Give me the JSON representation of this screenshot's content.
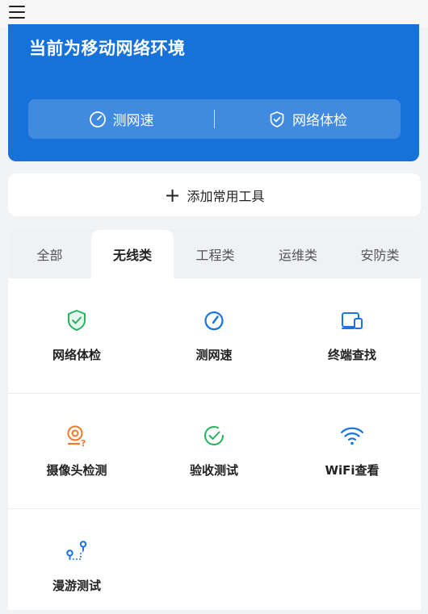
{
  "hero": {
    "title": "当前为移动网络环境",
    "speed_test_label": "测网速",
    "network_check_label": "网络体检"
  },
  "add_tools": {
    "label": "添加常用工具"
  },
  "tabs": [
    {
      "label": "全部",
      "active": false
    },
    {
      "label": "无线类",
      "active": true
    },
    {
      "label": "工程类",
      "active": false
    },
    {
      "label": "运维类",
      "active": false
    },
    {
      "label": "安防类",
      "active": false
    }
  ],
  "tools": [
    {
      "label": "网络体检",
      "icon": "shield-check-icon",
      "color": "#22b35e"
    },
    {
      "label": "测网速",
      "icon": "speedometer-icon",
      "color": "#1b75de"
    },
    {
      "label": "终端查找",
      "icon": "device-search-icon",
      "color": "#1b75de"
    },
    {
      "label": "摄像头检测",
      "icon": "camera-detect-icon",
      "color": "#f07a28"
    },
    {
      "label": "验收测试",
      "icon": "acceptance-check-icon",
      "color": "#22b35e"
    },
    {
      "label": "WiFi查看",
      "icon": "wifi-icon",
      "color": "#1b75de"
    },
    {
      "label": "漫游测试",
      "icon": "roaming-icon",
      "color": "#1b75de"
    }
  ],
  "colors": {
    "primary_blue": "#1672d9",
    "green": "#22b35e",
    "orange": "#f07a28"
  }
}
